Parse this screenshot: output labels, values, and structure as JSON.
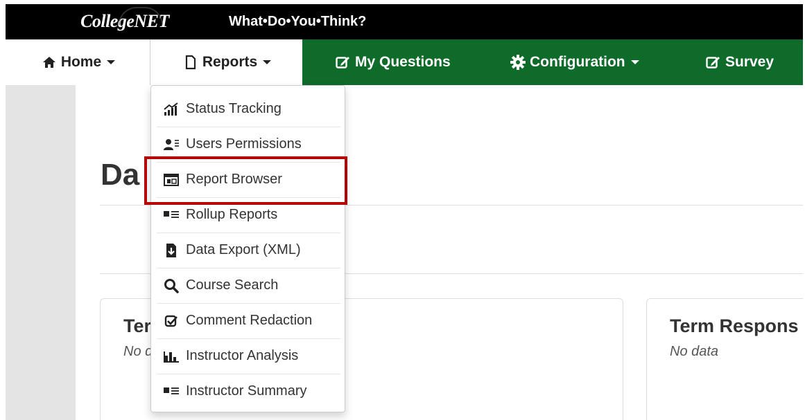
{
  "brand": {
    "logo_text": "CollegeNET",
    "tagline": "What•Do•You•Think?"
  },
  "nav": {
    "items": [
      {
        "label": "Home",
        "icon": "home-icon"
      },
      {
        "label": "Reports",
        "icon": "document-icon"
      },
      {
        "label": "My Questions",
        "icon": "edit-icon"
      },
      {
        "label": "Configuration",
        "icon": "gear-icon"
      },
      {
        "label": "Survey",
        "icon": "edit-icon"
      }
    ],
    "active_bg": "#ffffff",
    "bar_color": "#0f6b2a"
  },
  "dropdown": {
    "items": [
      {
        "label": "Status Tracking",
        "icon": "status-chart-icon"
      },
      {
        "label": "Users Permissions",
        "icon": "user-list-icon"
      },
      {
        "label": "Report Browser",
        "icon": "browser-window-icon"
      },
      {
        "label": "Rollup Reports",
        "icon": "list-icon"
      },
      {
        "label": "Data Export (XML)",
        "icon": "file-download-icon"
      },
      {
        "label": "Course Search",
        "icon": "search-icon"
      },
      {
        "label": "Comment Redaction",
        "icon": "check-square-icon"
      },
      {
        "label": "Instructor Analysis",
        "icon": "bar-chart-icon"
      },
      {
        "label": "Instructor Summary",
        "icon": "list-icon"
      }
    ],
    "highlighted": "Report Browser",
    "highlight_color": "#b30000"
  },
  "page": {
    "title": "Da",
    "panels": [
      {
        "title": "Ter",
        "nodata": "No d"
      },
      {
        "title": "Term Respons",
        "nodata": "No data"
      }
    ]
  }
}
